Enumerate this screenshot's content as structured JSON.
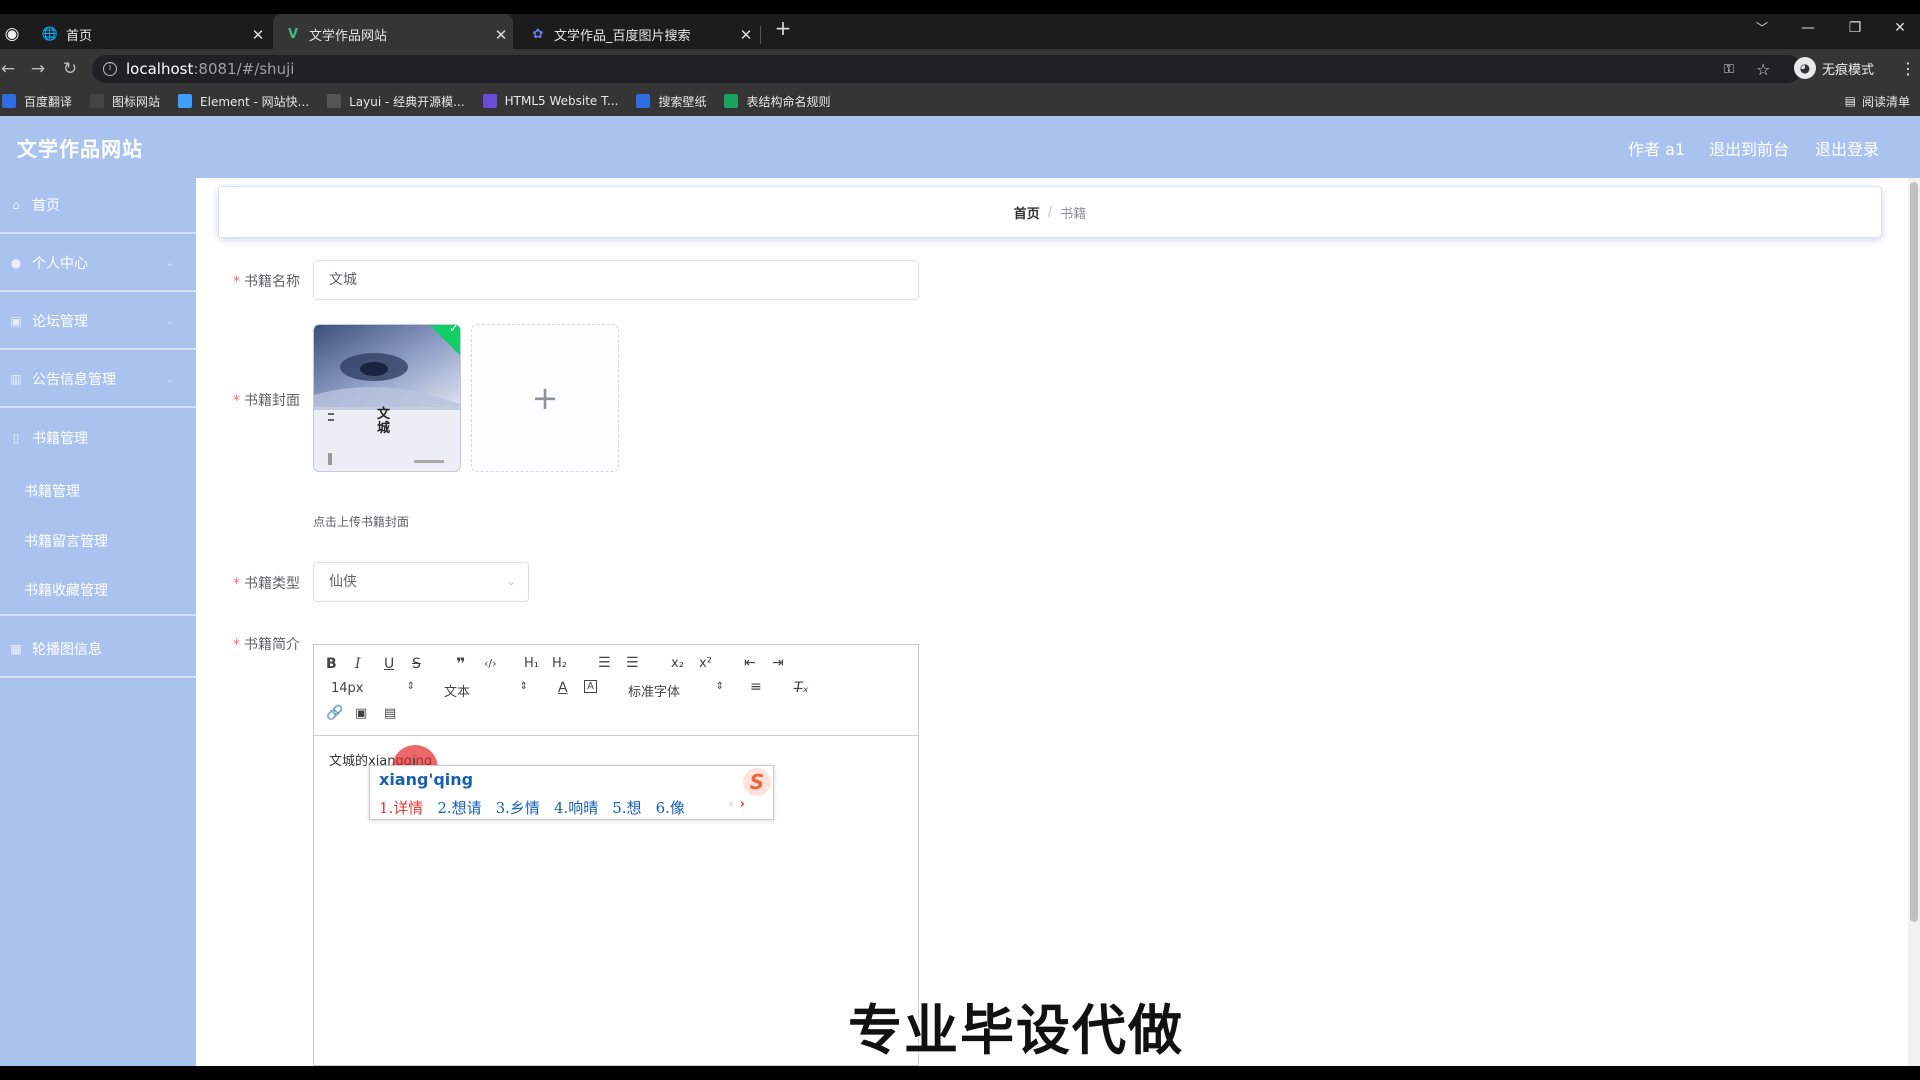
{
  "browser": {
    "tabs": [
      {
        "title": "首页",
        "active": false
      },
      {
        "title": "文学作品网站",
        "active": true
      },
      {
        "title": "文学作品_百度图片搜索",
        "active": false
      }
    ],
    "new_tab": "+",
    "url_host": "localhost",
    "url_path": ":8081/#/shuji",
    "profile_label": "无痕模式",
    "bookmarks": [
      {
        "label": "百度翻译",
        "icon": "baidu-translate-icon",
        "color": "#2f6de1"
      },
      {
        "label": "图标网站",
        "icon": "flag-icon",
        "color": "#444444"
      },
      {
        "label": "Element - 网站快...",
        "icon": "element-hex-icon",
        "color": "#409eff"
      },
      {
        "label": "Layui - 经典开源模...",
        "icon": "layui-icon",
        "color": "#555555"
      },
      {
        "label": "HTML5 Website T...",
        "icon": "html5-icon",
        "color": "#6a4bd8"
      },
      {
        "label": "搜索壁纸",
        "icon": "wallpaper-icon",
        "color": "#2f6de1"
      },
      {
        "label": "表结构命名规则",
        "icon": "table-icon",
        "color": "#1aa260"
      }
    ],
    "reading_list": "阅读清单"
  },
  "header": {
    "title": "文学作品网站",
    "links": [
      "作者 a1",
      "退出到前台",
      "退出登录"
    ]
  },
  "sidebar": {
    "items": [
      {
        "label": "首页",
        "icon": "home-icon"
      },
      {
        "label": "个人中心",
        "icon": "user-icon"
      },
      {
        "label": "论坛管理",
        "icon": "forum-icon"
      },
      {
        "label": "公告信息管理",
        "icon": "notice-icon"
      },
      {
        "label": "书籍管理",
        "icon": "book-icon"
      }
    ],
    "subitems": [
      "书籍管理",
      "书籍留言管理",
      "书籍收藏管理"
    ],
    "last_item": {
      "label": "轮播图信息",
      "icon": "carousel-icon"
    }
  },
  "breadcrumb": {
    "home": "首页",
    "separator": "/",
    "current": "书籍"
  },
  "form": {
    "name_label": "书籍名称",
    "name_value": "文城",
    "cover_label": "书籍封面",
    "cover_title": "文\n城",
    "cover_add": "+",
    "cover_tip": "点击上传书籍封面",
    "type_label": "书籍类型",
    "type_value": "仙侠",
    "intro_label": "书籍简介"
  },
  "editor": {
    "font_size": "14px",
    "header_select": "文本",
    "font_family": "标准字体",
    "content": "文城的xiangqing"
  },
  "ime": {
    "composition": "xiang'qing",
    "candidates": [
      "1.详情",
      "2.想请",
      "3.乡情",
      "4.响晴",
      "5.想",
      "6.像"
    ],
    "logo": "S"
  },
  "watermark": "专业毕设代做",
  "colors": {
    "theme": "#a9c3ee",
    "required": "#f56c6c",
    "ime_blue": "#1a5fb4",
    "ime_red": "#e53935"
  }
}
